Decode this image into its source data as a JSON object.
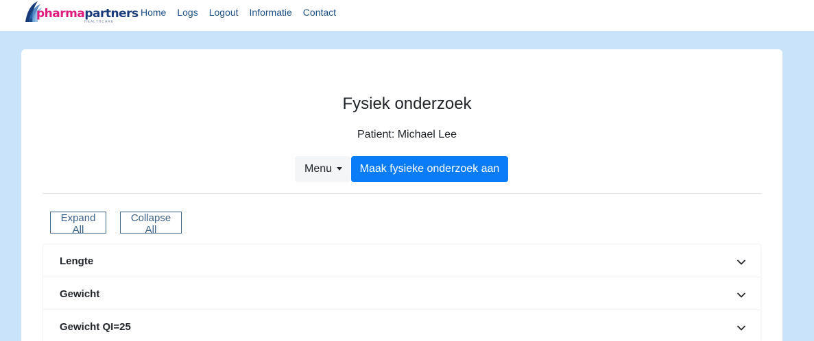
{
  "brand": {
    "name_part1": "pharma",
    "name_part2": "partners",
    "tagline": "HEALTHCARE",
    "badge": "TIB"
  },
  "nav": {
    "items": [
      "Home",
      "Logs",
      "Logout",
      "Informatie",
      "Contact"
    ]
  },
  "page": {
    "title": "Fysiek onderzoek",
    "patient_label": "Patient: Michael Lee"
  },
  "toolbar": {
    "menu_label": "Menu",
    "create_label": "Maak fysieke onderzoek aan"
  },
  "controls": {
    "expand_all": "Expand All",
    "collapse_all": "Collapse All"
  },
  "accordion": {
    "items": [
      "Lengte",
      "Gewicht",
      "Gewicht QI=25"
    ]
  },
  "colors": {
    "page_bg": "#c9e3fa",
    "primary": "#0a7cf7",
    "brand_pink": "#e0197d",
    "brand_navy": "#173a7a",
    "nav_link": "#1c4f85"
  }
}
